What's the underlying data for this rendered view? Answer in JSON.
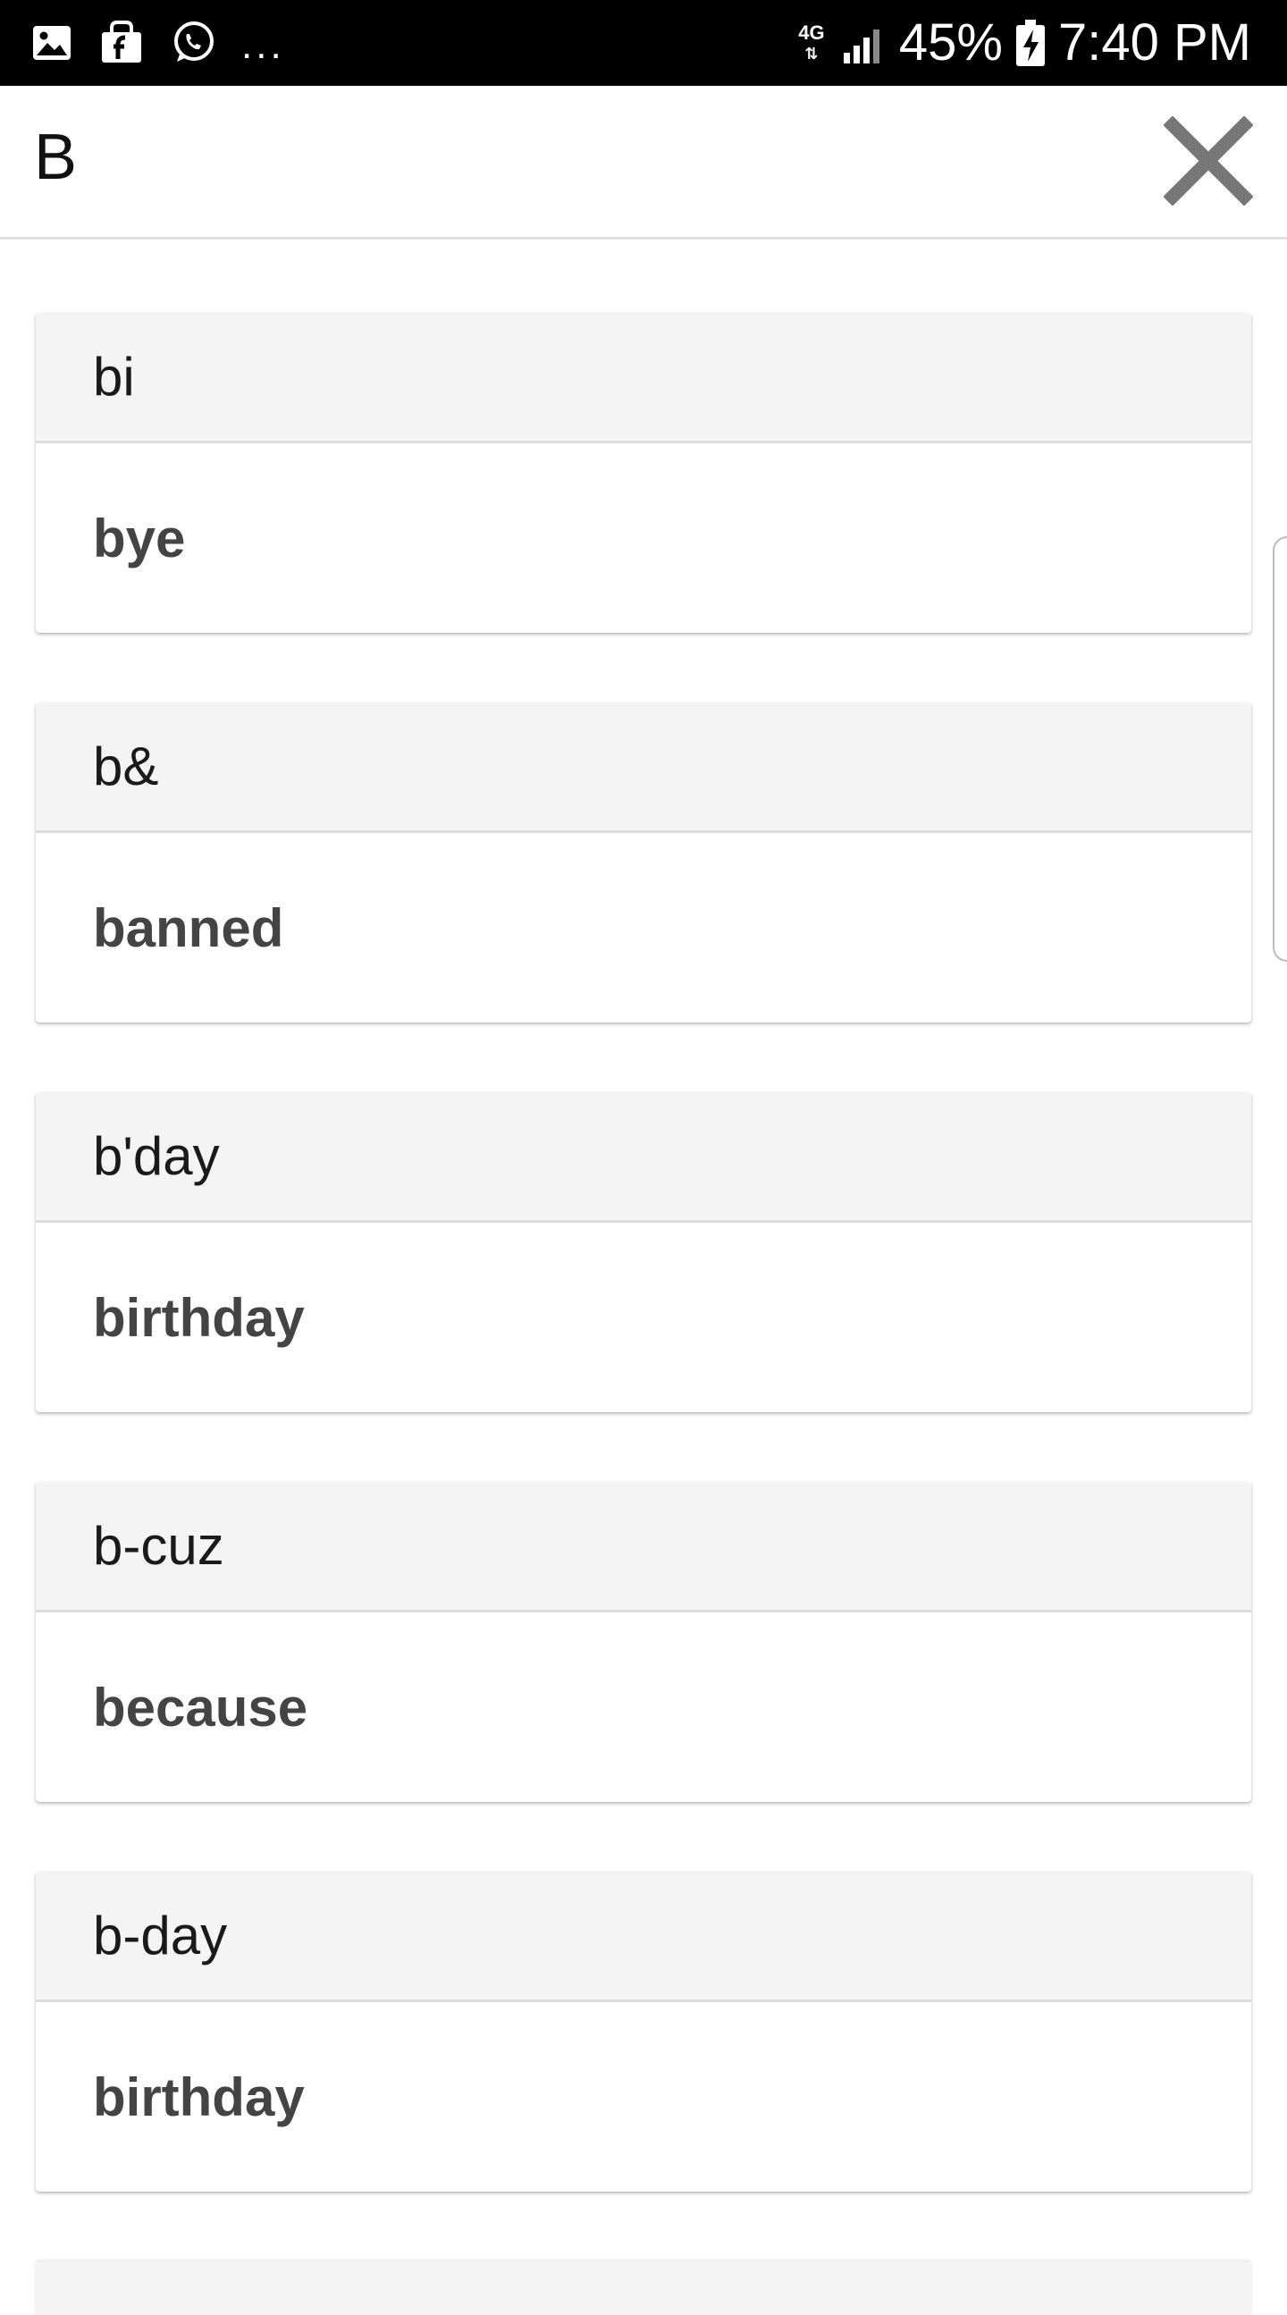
{
  "status_bar": {
    "notification_icons": [
      "image-icon",
      "shopping-bag-icon",
      "whatsapp-icon"
    ],
    "more_notifications": "...",
    "network_type": "4G",
    "battery_percent": "45%",
    "time": "7:40 PM"
  },
  "header": {
    "title": "B",
    "close_icon": "close-icon"
  },
  "entries": [
    {
      "term": "bi",
      "meaning": "bye"
    },
    {
      "term": "b&",
      "meaning": "banned"
    },
    {
      "term": "b'day",
      "meaning": "birthday"
    },
    {
      "term": "b-cuz",
      "meaning": "because"
    },
    {
      "term": "b-day",
      "meaning": "birthday"
    }
  ],
  "colors": {
    "status_bar_bg": "#000000",
    "card_header_bg": "#f4f4f4",
    "close_icon": "#777777",
    "meaning_text": "#444444"
  }
}
